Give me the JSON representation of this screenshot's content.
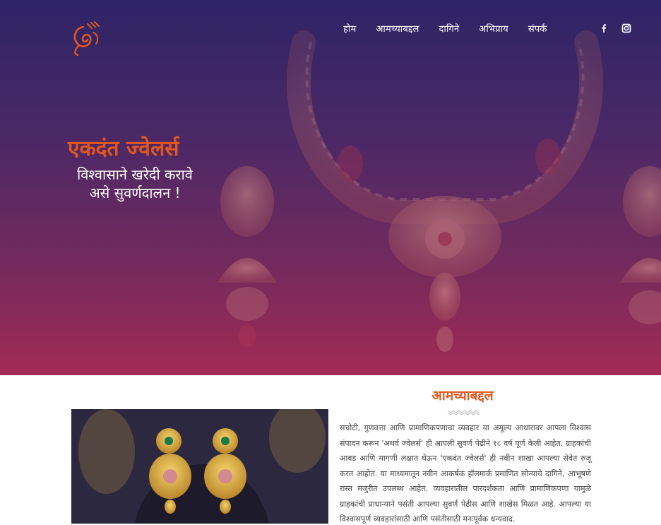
{
  "nav": {
    "items": [
      {
        "label": "होम"
      },
      {
        "label": "आमच्याबद्दल"
      },
      {
        "label": "दागिने"
      },
      {
        "label": "अभिप्राय"
      },
      {
        "label": "संपर्क"
      }
    ],
    "social": [
      "facebook-icon",
      "instagram-icon"
    ]
  },
  "hero": {
    "title": "एकदंत ज्वेलर्स",
    "subtitle_line1": "विश्वासाने खरेदी करावे",
    "subtitle_line2": "असे सुवर्णदालन !"
  },
  "about": {
    "heading": "आमच्याबद्दल",
    "text": "सचोटी, गुणवत्ता आणि प्रामाणिकपणाचा व्यवहार या अमूल्य आधारावर आपला विश्वास संपादन करून 'अथर्व ज्वेलर्स' ही आपली सुवर्ण पेढीने १८ वर्ष पूर्ण केली आहेत. ग्राहकांची आवड आणि मागणी लक्षात घेऊन 'एकदंत ज्वेलर्स' ही नवीन शाखा आपल्या सेवेत रुजू करत आहोत. या माध्यमातून नवीन आकर्षक हॉलमार्क प्रमाणित सोन्याचे दागिने, आभूषणे रास्त मजुरीत उपलब्ध आहेत. व्यवहारातील पारदर्शकता आणि प्रामाणिकपणा यामुळे ग्राहकांची प्राधान्याने पसंती आपल्या सुवर्ण पेढीस आणि शाखेस मिळत आहे. आपल्या या विश्वासपूर्ण व्यवहारांसाठी आणि पसंतीसाठी मनःपूर्वक धन्यवाद."
  },
  "colors": {
    "accent": "#e2571e",
    "hero_top": "#2d2467",
    "hero_bottom": "#a32b54"
  }
}
